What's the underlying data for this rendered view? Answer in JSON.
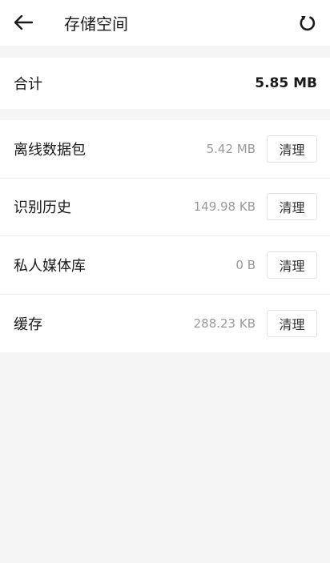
{
  "header": {
    "title": "存储空间",
    "back_icon": "arrow-left-icon",
    "refresh_icon": "refresh-icon"
  },
  "total": {
    "label": "合计",
    "value": "5.85 MB"
  },
  "items": [
    {
      "label": "离线数据包",
      "size": "5.42 MB",
      "button": "清理"
    },
    {
      "label": "识别历史",
      "size": "149.98 KB",
      "button": "清理"
    },
    {
      "label": "私人媒体库",
      "size": "0 B",
      "button": "清理"
    },
    {
      "label": "缓存",
      "size": "288.23 KB",
      "button": "清理"
    }
  ],
  "colors": {
    "background": "#f5f5f5",
    "surface": "#ffffff",
    "text": "#1a1a1a",
    "muted": "#9a9a9a"
  }
}
